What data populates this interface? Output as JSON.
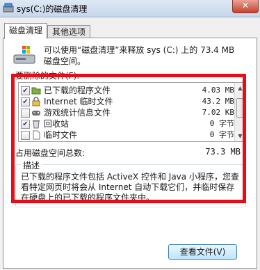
{
  "window": {
    "title": "sys(C:)的磁盘清理",
    "close_glyph": "✕"
  },
  "tabs": [
    {
      "label": "磁盘清理",
      "active": true
    },
    {
      "label": "其他选项",
      "active": false
    }
  ],
  "intro": "可以使用“磁盘清理”来释放 sys (C:) 上的 73.4 MB\n磁盘空间。",
  "list_label": "要删除的文件(F):",
  "files": [
    {
      "checked": true,
      "name": "已下载的程序文件",
      "size": "4.03 MB",
      "icon": "folder-icon"
    },
    {
      "checked": true,
      "name": "Internet 临时文件",
      "size": "43.2 MB",
      "icon": "lock-icon"
    },
    {
      "checked": false,
      "name": "游戏统计信息文件",
      "size": "7.02 KB",
      "icon": "game-icon"
    },
    {
      "checked": true,
      "name": "回收站",
      "size": "0 字节",
      "icon": "recycle-bin-icon"
    },
    {
      "checked": false,
      "name": "临时文件",
      "size": "0 字节",
      "icon": "file-icon"
    }
  ],
  "total": {
    "label": "占用磁盘空间总数:",
    "value": "73.3 MB"
  },
  "description": {
    "title": "描述",
    "text": "已下载的程序文件包括 ActiveX 控件和 Java 小程序，您查看特定网页时将会从 Internet 自动下载它们，并临时保存在硬盘上的已下载的程序文件夹中。"
  },
  "buttons": {
    "view_files": "查看文件(V)"
  },
  "colors": {
    "highlight_border": "#e60d19",
    "title_bar": "#c7d6ea"
  }
}
